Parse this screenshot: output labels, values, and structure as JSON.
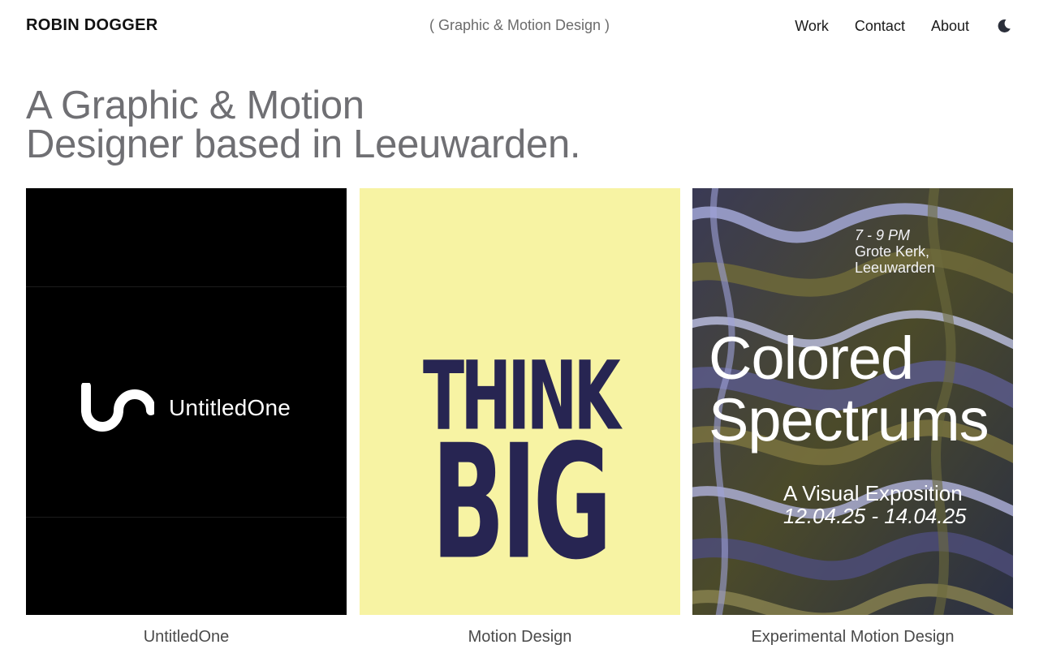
{
  "header": {
    "logo": "ROBIN DOGGER",
    "tagline": "( Graphic & Motion Design )",
    "nav": [
      "Work",
      "Contact",
      "About"
    ],
    "theme_icon": "moon-icon"
  },
  "hero": {
    "line1": "A Graphic & Motion",
    "line2": "Designer based in Leeuwarden."
  },
  "projects": [
    {
      "caption": "UntitledOne",
      "artwork": {
        "brand_name": "UntitledOne",
        "logo_icon": "untitledone-logo-icon",
        "background": "#000000"
      }
    },
    {
      "caption": "Motion Design",
      "artwork": {
        "word1": "THINK",
        "word2": "BIG",
        "background": "#f7f3a3",
        "ink": "#272552"
      }
    },
    {
      "caption": "Experimental Motion Design",
      "artwork": {
        "time": "7 - 9 PM",
        "venue_line1": "Grote Kerk,",
        "venue_line2": "Leeuwarden",
        "title_line1": "Colored",
        "title_line2": "Spectrums",
        "subtitle": "A Visual Exposition",
        "dates": "12.04.25 - 14.04.25"
      }
    }
  ]
}
